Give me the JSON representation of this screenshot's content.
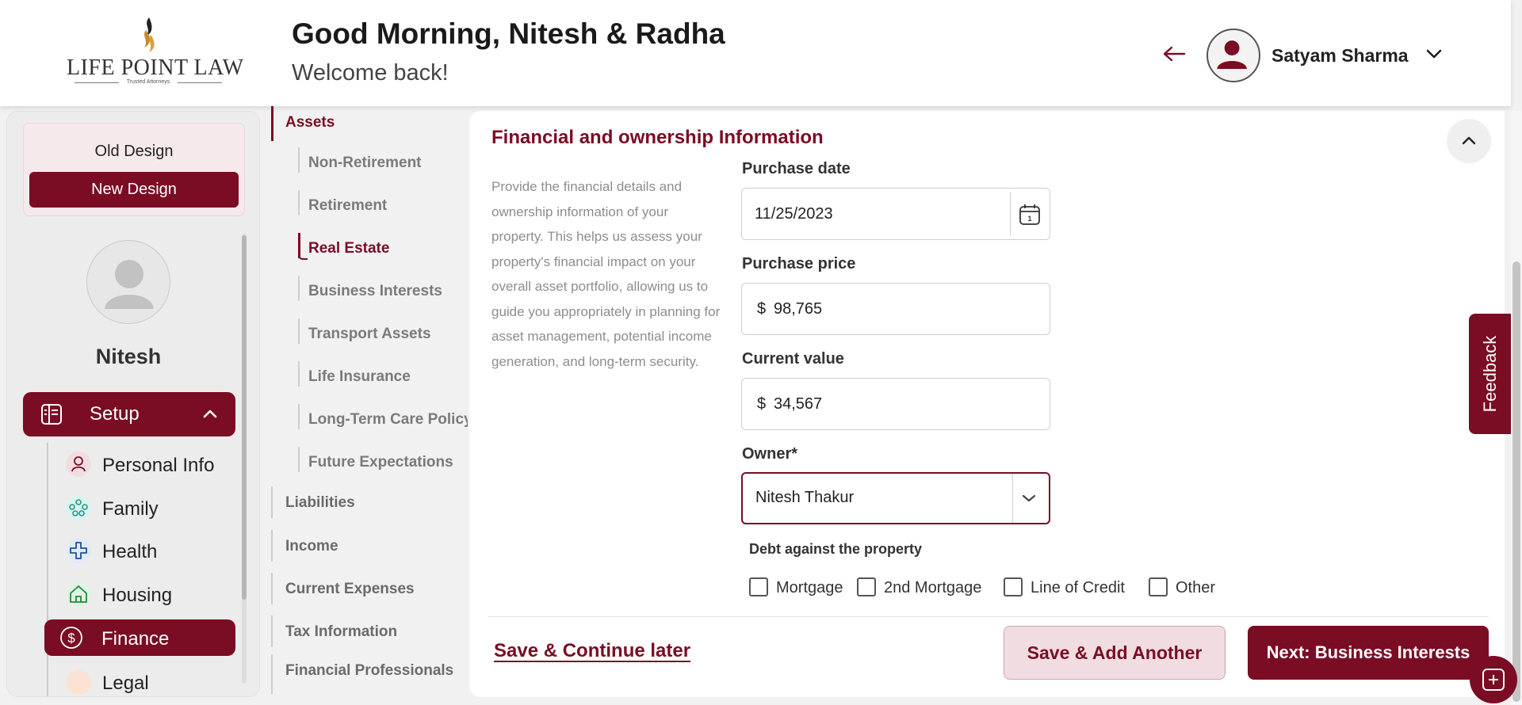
{
  "header": {
    "logo_text": "LIFE POINT LAW",
    "logo_tagline": "Trusted Attorneys",
    "greeting": "Good Morning, Nitesh & Radha",
    "welcome": "Welcome back!",
    "user_name": "Satyam Sharma",
    "icons": [
      "back-arrow-icon",
      "user-avatar-icon",
      "chevron-down-icon"
    ]
  },
  "sidebar": {
    "old_design": "Old Design",
    "new_design": "New Design",
    "profile_name": "Nitesh",
    "setup_label": "Setup",
    "items": [
      {
        "label": "Personal Info",
        "icon": "person-icon"
      },
      {
        "label": "Family",
        "icon": "family-icon"
      },
      {
        "label": "Health",
        "icon": "health-cross-icon"
      },
      {
        "label": "Housing",
        "icon": "house-icon"
      },
      {
        "label": "Finance",
        "icon": "dollar-icon",
        "active": true
      },
      {
        "label": "Legal",
        "icon": "legal-icon"
      }
    ]
  },
  "subnav": {
    "assets": "Assets",
    "asset_children": [
      "Non-Retirement",
      "Retirement",
      "Real Estate",
      "Business Interests",
      "Transport Assets",
      "Life Insurance",
      "Long-Term Care Policy",
      "Future Expectations"
    ],
    "active_child": "Real Estate",
    "sections": [
      "Liabilities",
      "Income",
      "Current Expenses",
      "Tax Information",
      "Financial Professionals"
    ]
  },
  "form": {
    "title": "Financial and ownership Information",
    "description": "Provide the financial details and ownership information of your property. This helps us assess your property's financial impact on your overall asset portfolio, allowing us to guide you appropriately in planning for asset management, potential income generation, and long-term security.",
    "purchase_date": {
      "label": "Purchase date",
      "value": "11/25/2023"
    },
    "purchase_price": {
      "label": "Purchase price",
      "currency": "$",
      "value": "98,765"
    },
    "current_value": {
      "label": "Current value",
      "currency": "$",
      "value": "34,567"
    },
    "owner": {
      "label": "Owner*",
      "value": "Nitesh Thakur"
    },
    "debt_label": "Debt against the property",
    "debt_options": [
      {
        "label": "Mortgage",
        "checked": false
      },
      {
        "label": "2nd Mortgage",
        "checked": false
      },
      {
        "label": "Line of Credit",
        "checked": false
      },
      {
        "label": "Other",
        "checked": false
      }
    ]
  },
  "actions": {
    "save_later": "Save & Continue later",
    "save_add": "Save & Add Another",
    "next": "Next: Business Interests"
  },
  "feedback": "Feedback",
  "colors": {
    "brand": "#7a0c24",
    "brand_light": "#f1dde1",
    "background": "#f1f1f1"
  }
}
